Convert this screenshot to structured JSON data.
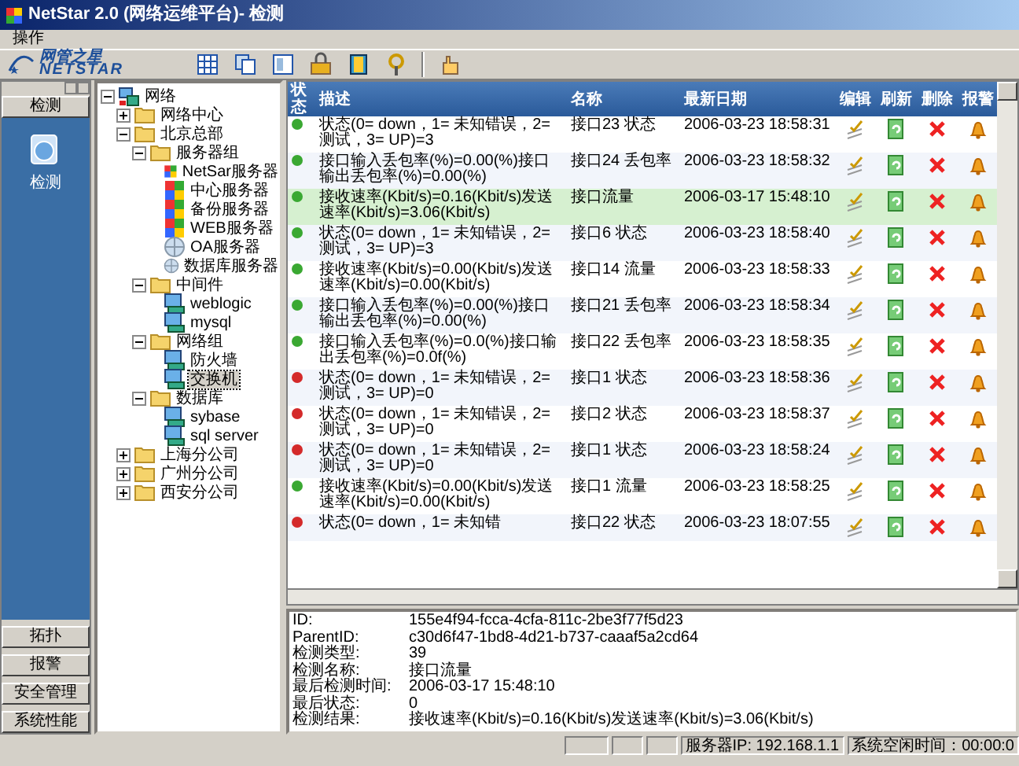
{
  "window": {
    "title": "NetStar 2.0 (网络运维平台)- 检测"
  },
  "menu": [
    "操作"
  ],
  "toolbar": {
    "logo_cn": "网管之星",
    "logo_en": "NETSTAR"
  },
  "outlook_bar": {
    "header": "检测",
    "item": "检测",
    "buttons": [
      "拓扑",
      "报警",
      "安全管理",
      "系统性能"
    ]
  },
  "tree": [
    {
      "label": "网络",
      "kind": "network",
      "expanded": true,
      "selected": false,
      "children": [
        {
          "label": "网络中心",
          "kind": "folder",
          "expanded": false,
          "selected": false
        },
        {
          "label": "北京总部",
          "kind": "folder",
          "expanded": true,
          "selected": false,
          "children": [
            {
              "label": "服务器组",
              "kind": "folder",
              "expanded": true,
              "selected": false,
              "children": [
                {
                  "label": "NetSar服务器",
                  "kind": "server",
                  "selected": false
                },
                {
                  "label": "中心服务器",
                  "kind": "server",
                  "selected": false
                },
                {
                  "label": "备份服务器",
                  "kind": "server",
                  "selected": false
                },
                {
                  "label": "WEB服务器",
                  "kind": "server",
                  "selected": false
                },
                {
                  "label": "OA服务器",
                  "kind": "globe",
                  "selected": false
                },
                {
                  "label": "数据库服务器",
                  "kind": "globe",
                  "selected": false
                }
              ]
            },
            {
              "label": "中间件",
              "kind": "folder",
              "expanded": true,
              "selected": false,
              "children": [
                {
                  "label": "weblogic",
                  "kind": "host",
                  "selected": false
                },
                {
                  "label": "mysql",
                  "kind": "host",
                  "selected": false
                }
              ]
            },
            {
              "label": "网络组",
              "kind": "folder",
              "expanded": true,
              "selected": false,
              "children": [
                {
                  "label": "防火墙",
                  "kind": "host",
                  "selected": false
                },
                {
                  "label": "交换机",
                  "kind": "host",
                  "selected": true
                }
              ]
            },
            {
              "label": "数据库",
              "kind": "folder",
              "expanded": true,
              "selected": false,
              "children": [
                {
                  "label": "sybase",
                  "kind": "host",
                  "selected": false
                },
                {
                  "label": "sql server",
                  "kind": "host",
                  "selected": false
                }
              ]
            }
          ]
        },
        {
          "label": "上海分公司",
          "kind": "folder",
          "expanded": false,
          "selected": false
        },
        {
          "label": "广州分公司",
          "kind": "folder",
          "expanded": false,
          "selected": false
        },
        {
          "label": "西安分公司",
          "kind": "folder",
          "expanded": false,
          "selected": false
        }
      ]
    }
  ],
  "table": {
    "columns": [
      "状态",
      "描述",
      "名称",
      "最新日期",
      "编辑",
      "刷新",
      "删除",
      "报警"
    ],
    "rows": [
      {
        "color": "#3aa832",
        "selected": false,
        "description": "状态(0= down，1= 未知错误，2= 测试，3= UP)=3",
        "name": "接口23 状态",
        "date": "2006-03-23 18:58:31"
      },
      {
        "color": "#3aa832",
        "selected": false,
        "description": "接口输入丢包率(%)=0.00(%)接口输出丢包率(%)=0.00(%)",
        "name": "接口24 丢包率",
        "date": "2006-03-23 18:58:32"
      },
      {
        "color": "#3aa832",
        "selected": true,
        "description": "接收速率(Kbit/s)=0.16(Kbit/s)发送速率(Kbit/s)=3.06(Kbit/s)",
        "name": "接口流量",
        "date": "2006-03-17 15:48:10"
      },
      {
        "color": "#3aa832",
        "selected": false,
        "description": "状态(0= down，1= 未知错误，2= 测试，3= UP)=3",
        "name": "接口6 状态",
        "date": "2006-03-23 18:58:40"
      },
      {
        "color": "#3aa832",
        "selected": false,
        "description": "接收速率(Kbit/s)=0.00(Kbit/s)发送速率(Kbit/s)=0.00(Kbit/s)",
        "name": "接口14 流量",
        "date": "2006-03-23 18:58:33"
      },
      {
        "color": "#3aa832",
        "selected": false,
        "description": "接口输入丢包率(%)=0.00(%)接口输出丢包率(%)=0.00(%)",
        "name": "接口21 丢包率",
        "date": "2006-03-23 18:58:34"
      },
      {
        "color": "#3aa832",
        "selected": false,
        "description": "接口输入丢包率(%)=0.0(%)接口输出丢包率(%)=0.0f(%)",
        "name": "接口22 丢包率",
        "date": "2006-03-23 18:58:35"
      },
      {
        "color": "#d42a2a",
        "selected": false,
        "description": "状态(0= down，1= 未知错误，2= 测试，3= UP)=0",
        "name": "接口1 状态",
        "date": "2006-03-23 18:58:36"
      },
      {
        "color": "#d42a2a",
        "selected": false,
        "description": "状态(0= down，1= 未知错误，2= 测试，3= UP)=0",
        "name": "接口2 状态",
        "date": "2006-03-23 18:58:37"
      },
      {
        "color": "#d42a2a",
        "selected": false,
        "description": "状态(0= down，1= 未知错误，2= 测试，3= UP)=0",
        "name": "接口1 状态",
        "date": "2006-03-23 18:58:24"
      },
      {
        "color": "#3aa832",
        "selected": false,
        "description": "接收速率(Kbit/s)=0.00(Kbit/s)发送速率(Kbit/s)=0.00(Kbit/s)",
        "name": "接口1 流量",
        "date": "2006-03-23 18:58:25"
      },
      {
        "color": "#d42a2a",
        "selected": false,
        "description": "状态(0= down，1= 未知错",
        "name": "接口22 状态",
        "date": "2006-03-23 18:07:55"
      }
    ]
  },
  "details": [
    {
      "label": "ID:",
      "value": "155e4f94-fcca-4cfa-811c-2be3f77f5d23"
    },
    {
      "label": "ParentID:",
      "value": "c30d6f47-1bd8-4d21-b737-caaaf5a2cd64"
    },
    {
      "label": "检测类型:",
      "value": "39"
    },
    {
      "label": "检测名称:",
      "value": "接口流量"
    },
    {
      "label": "最后检测时间:",
      "value": "2006-03-17 15:48:10"
    },
    {
      "label": "最后状态:",
      "value": "0"
    },
    {
      "label": "检测结果:",
      "value": "接收速率(Kbit/s)=0.16(Kbit/s)发送速率(Kbit/s)=3.06(Kbit/s)"
    }
  ],
  "status_bar": {
    "server_ip": "服务器IP: 192.168.1.1",
    "idle_time": "系统空闲时间：00:00:0"
  }
}
